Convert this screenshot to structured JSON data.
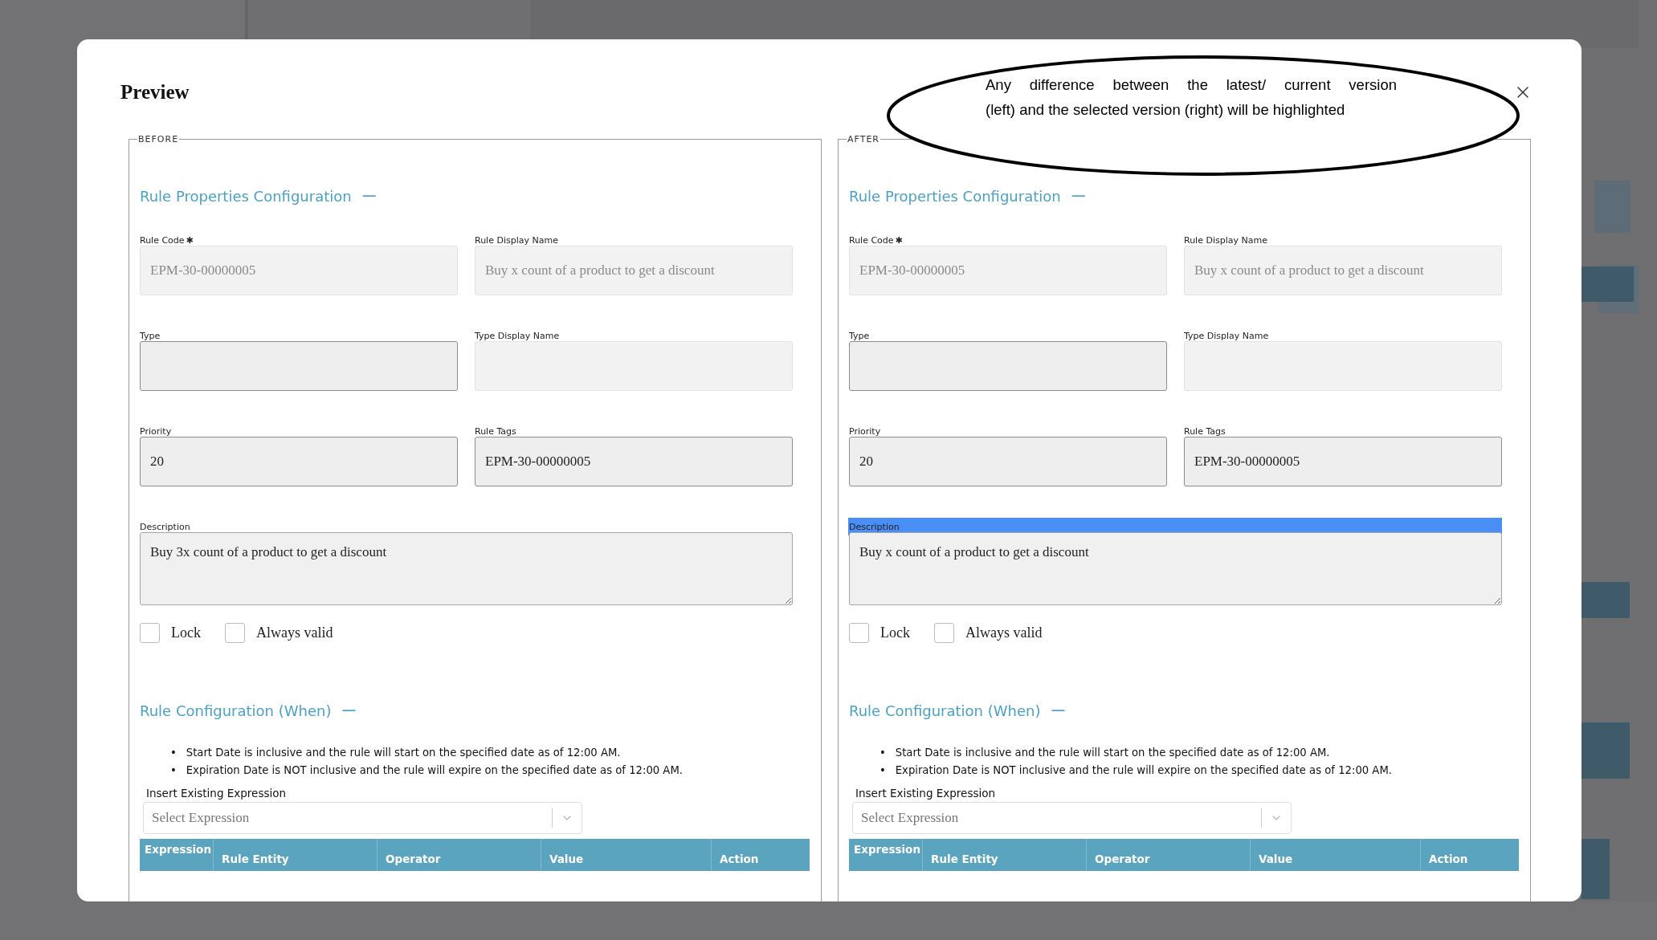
{
  "dialog": {
    "title": "Preview"
  },
  "annotation": {
    "lines": [
      "Any difference between the latest/ current version",
      "(left) and the selected version (right) will be highlighted"
    ]
  },
  "panels": [
    {
      "legend": "BEFORE",
      "properties": {
        "title": "Rule Properties Configuration",
        "toggle": "—",
        "fields": [
          {
            "kind": "input",
            "label": "Rule Code",
            "required_mark": "✱",
            "value": "EPM-30-00000005",
            "disabled": true
          },
          {
            "kind": "input",
            "label": "Rule Display Name",
            "value": "Buy x count of a product to get a discount",
            "disabled": true
          },
          {
            "kind": "input",
            "label": "Type",
            "disabled": false
          },
          {
            "kind": "input",
            "label": "Type Display Name",
            "disabled": true
          },
          {
            "kind": "input",
            "label": "Priority",
            "value": "20",
            "disabled": false
          },
          {
            "kind": "input",
            "label": "Rule Tags",
            "value": "EPM-30-00000005",
            "disabled": false
          },
          {
            "kind": "textarea",
            "label": "Description",
            "value": "Buy 3x count of a product to get a discount",
            "highlighted": false
          }
        ],
        "checkboxes": [
          {
            "label": "Lock",
            "checked": false
          },
          {
            "label": "Always valid",
            "checked": false
          }
        ]
      },
      "when": {
        "title": "Rule Configuration (When)",
        "toggle": "—",
        "notes": [
          {
            "bullet": "•",
            "text": "Start Date is inclusive and the rule will start on the specified date as of 12:00 AM."
          },
          {
            "bullet": "•",
            "text": "Expiration Date is NOT inclusive and the rule will expire on the specified date as of 12:00 AM."
          }
        ],
        "expression_label": "Insert Existing Expression",
        "select": {
          "placeholder": "Select Expression"
        },
        "table": {
          "columns": [
            "Expression",
            "Rule Entity",
            "Operator",
            "Value",
            "Action"
          ]
        }
      }
    },
    {
      "legend": "AFTER",
      "properties": {
        "title": "Rule Properties Configuration",
        "toggle": "—",
        "fields": [
          {
            "kind": "input",
            "label": "Rule Code",
            "required_mark": "✱",
            "value": "EPM-30-00000005",
            "disabled": true
          },
          {
            "kind": "input",
            "label": "Rule Display Name",
            "value": "Buy x count of a product to get a discount",
            "disabled": true
          },
          {
            "kind": "input",
            "label": "Type",
            "disabled": false
          },
          {
            "kind": "input",
            "label": "Type Display Name",
            "disabled": true
          },
          {
            "kind": "input",
            "label": "Priority",
            "value": "20",
            "disabled": false
          },
          {
            "kind": "input",
            "label": "Rule Tags",
            "value": "EPM-30-00000005",
            "disabled": false
          },
          {
            "kind": "textarea",
            "label": "Description",
            "value": "Buy x count of a product to get a discount",
            "highlighted": true
          }
        ],
        "checkboxes": [
          {
            "label": "Lock",
            "checked": false
          },
          {
            "label": "Always valid",
            "checked": false
          }
        ]
      },
      "when": {
        "title": "Rule Configuration (When)",
        "toggle": "—",
        "notes": [
          {
            "bullet": "•",
            "text": "Start Date is inclusive and the rule will start on the specified date as of 12:00 AM."
          },
          {
            "bullet": "•",
            "text": "Expiration Date is NOT inclusive and the rule will expire on the specified date as of 12:00 AM."
          }
        ],
        "expression_label": "Insert Existing Expression",
        "select": {
          "placeholder": "Select Expression"
        },
        "table": {
          "columns": [
            "Expression",
            "Rule Entity",
            "Operator",
            "Value",
            "Action"
          ]
        }
      }
    }
  ]
}
